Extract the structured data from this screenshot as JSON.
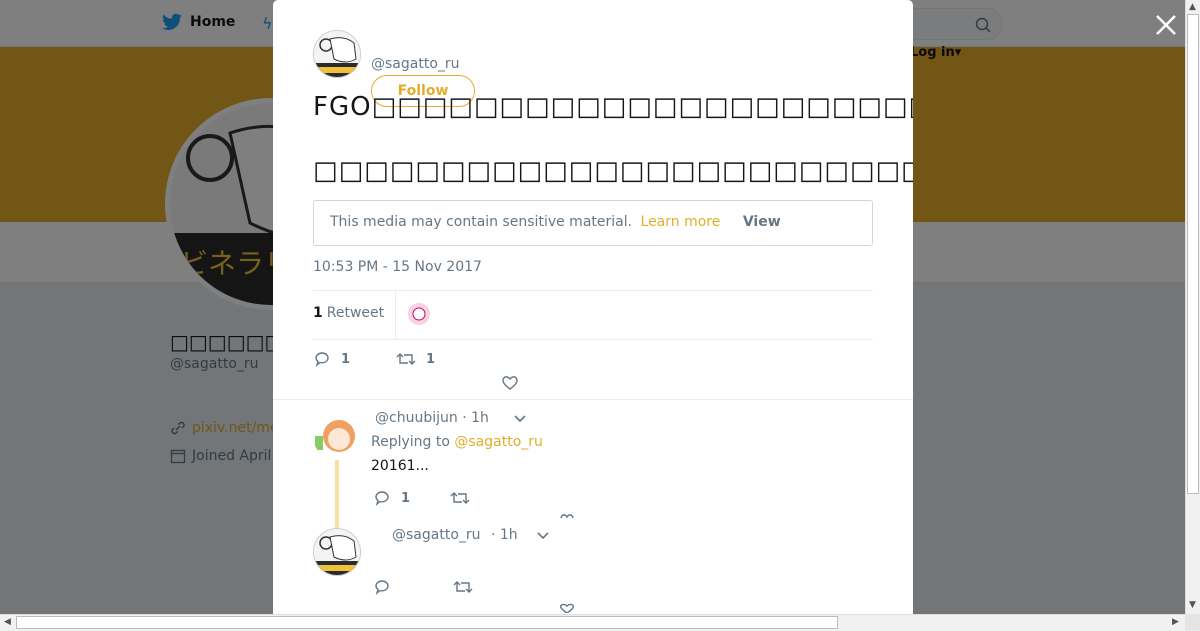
{
  "topnav": {
    "home_label": "Home",
    "login_label": "Log in"
  },
  "profile": {
    "name": "□□□□□□",
    "handle": "@sagatto_ru",
    "link": "pixiv.net/me",
    "joined": "Joined April"
  },
  "modal": {
    "handle": "@sagatto_ru",
    "follow_label": "Follow",
    "tweet_line1": "FGO□□□□□□□□□□□□□□□□□□□□□□□□□□□□□□□□□□□□□□□□□(□□",
    "tweet_line2": "□□□□□□□□□□□□□□□□□□□□□□□□□□□□□□□□□□□□□□□□□□□□□□□□",
    "sensitive_text": "This media may contain sensitive material.",
    "learn_more": "Learn more",
    "view_label": "View",
    "timestamp": "10:53 PM - 15 Nov 2017",
    "retweet_count": "1",
    "retweet_label": "Retweet",
    "reply_count": "1",
    "rt_count": "1"
  },
  "replies": [
    {
      "handle": "@chuubijun",
      "time": "· 1h",
      "replying_to_label": "Replying to",
      "replying_to": "@sagatto_ru",
      "text": "20161...",
      "reply_count": "1"
    },
    {
      "handle": "@sagatto_ru",
      "time": "· 1h"
    }
  ],
  "colors": {
    "accent": "#e2ad2b",
    "twitter_blue": "#1da1f2"
  }
}
